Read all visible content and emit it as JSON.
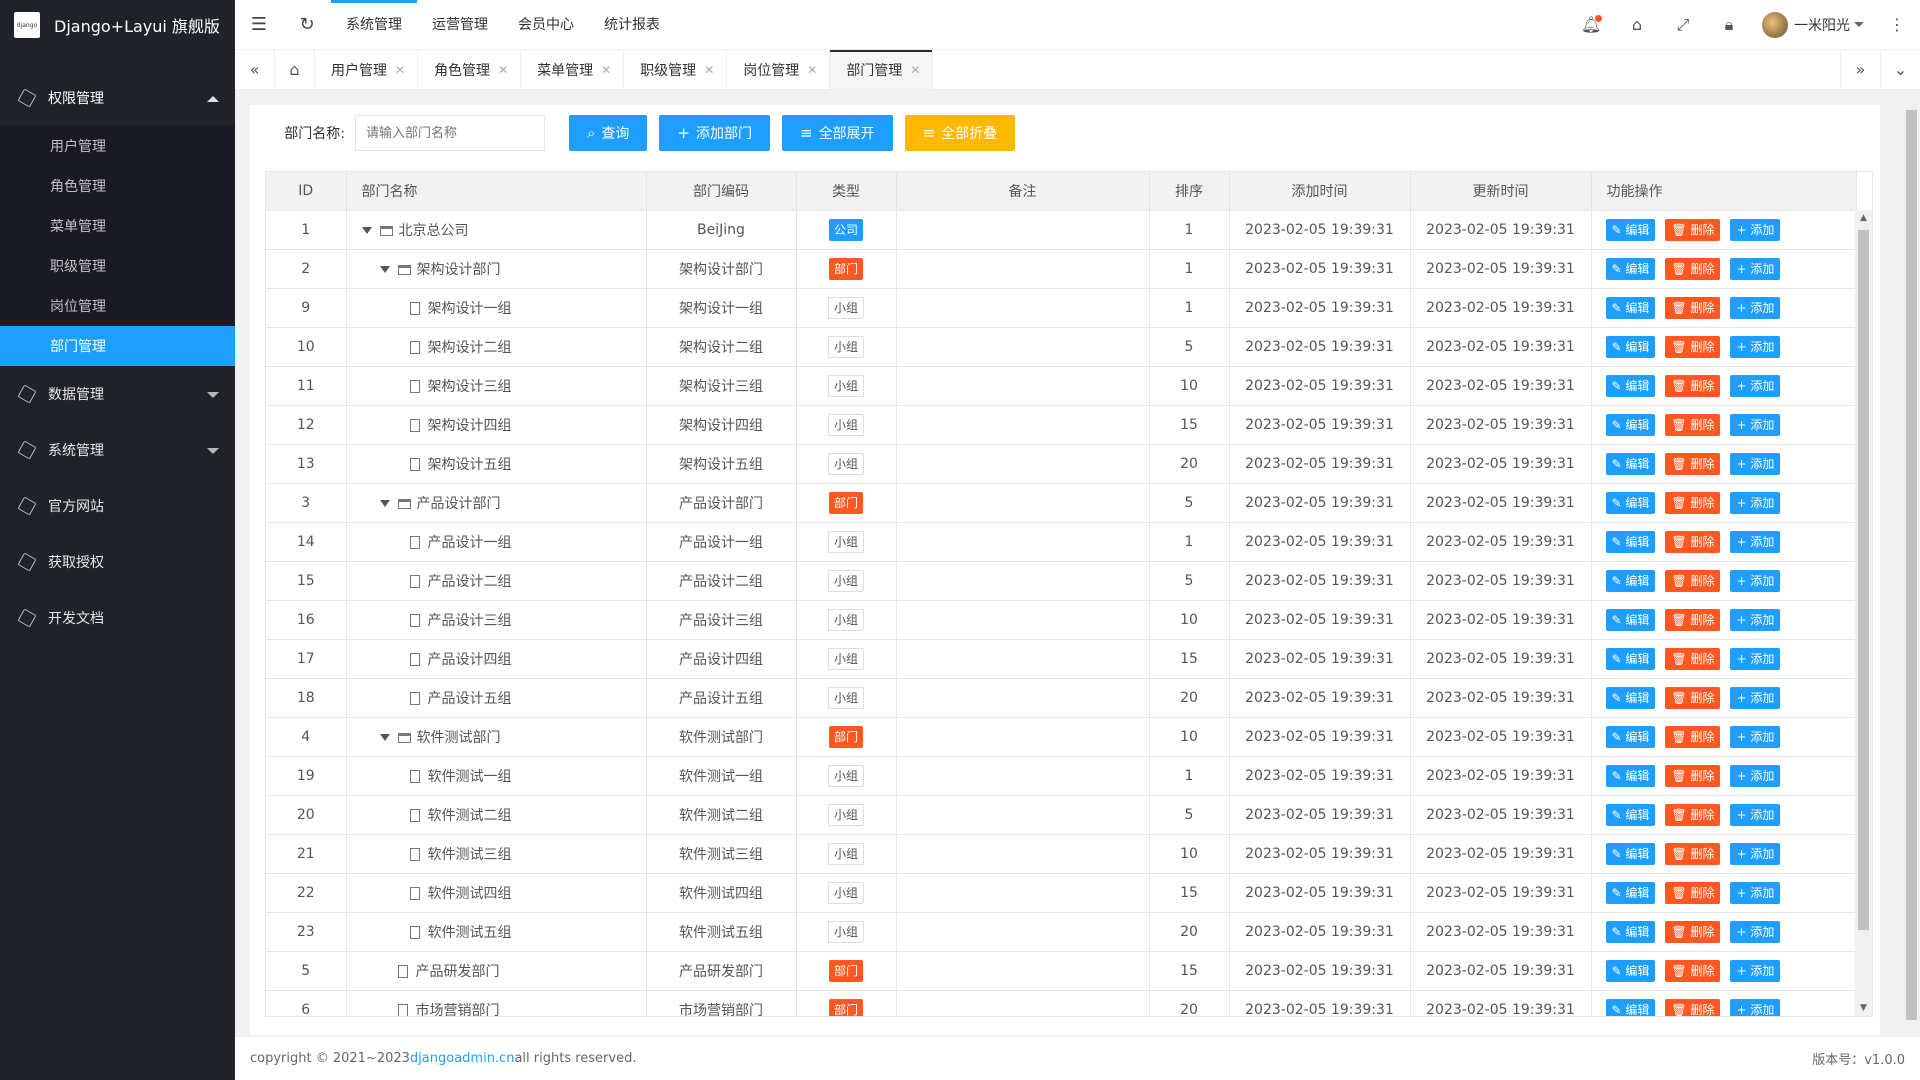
{
  "app": {
    "title": "Django+Layui 旗舰版",
    "logo_text": "django"
  },
  "sidebar": {
    "groups": [
      {
        "label": "权限管理",
        "expanded": true,
        "icon": "cube-icon",
        "items": [
          {
            "label": "用户管理",
            "active": false
          },
          {
            "label": "角色管理",
            "active": false
          },
          {
            "label": "菜单管理",
            "active": false
          },
          {
            "label": "职级管理",
            "active": false
          },
          {
            "label": "岗位管理",
            "active": false
          },
          {
            "label": "部门管理",
            "active": true
          }
        ]
      },
      {
        "label": "数据管理",
        "expanded": false,
        "has_children": true
      },
      {
        "label": "系统管理",
        "expanded": false,
        "has_children": true
      },
      {
        "label": "官方网站",
        "expanded": false,
        "has_children": false
      },
      {
        "label": "获取授权",
        "expanded": false,
        "has_children": false
      },
      {
        "label": "开发文档",
        "expanded": false,
        "has_children": false
      }
    ]
  },
  "header": {
    "menu": [
      "系统管理",
      "运营管理",
      "会员中心",
      "统计报表"
    ],
    "active_menu": 0,
    "user_name": "一米阳光"
  },
  "tabs": {
    "items": [
      "用户管理",
      "角色管理",
      "菜单管理",
      "职级管理",
      "岗位管理",
      "部门管理"
    ],
    "active": 5
  },
  "search": {
    "label": "部门名称:",
    "placeholder": "请输入部门名称",
    "buttons": {
      "query": "查询",
      "add": "添加部门",
      "expand": "全部展开",
      "collapse": "全部折叠"
    }
  },
  "table": {
    "columns": [
      "ID",
      "部门名称",
      "部门编码",
      "类型",
      "备注",
      "排序",
      "添加时间",
      "更新时间",
      "功能操作"
    ],
    "ops": {
      "edit": "编辑",
      "delete": "删除",
      "add": "添加"
    },
    "type_labels": {
      "company": "公司",
      "dept": "部门",
      "group": "小组"
    },
    "rows": [
      {
        "id": "1",
        "name": "北京总公司",
        "code": "BeiJing",
        "type": "company",
        "level": 0,
        "node": "folder",
        "sort": "1",
        "created": "2023-02-05 19:39:31",
        "updated": "2023-02-05 19:39:31"
      },
      {
        "id": "2",
        "name": "架构设计部门",
        "code": "架构设计部门",
        "type": "dept",
        "level": 1,
        "node": "folder",
        "sort": "1",
        "created": "2023-02-05 19:39:31",
        "updated": "2023-02-05 19:39:31"
      },
      {
        "id": "9",
        "name": "架构设计一组",
        "code": "架构设计一组",
        "type": "group",
        "level": 2,
        "node": "file",
        "sort": "1",
        "created": "2023-02-05 19:39:31",
        "updated": "2023-02-05 19:39:31"
      },
      {
        "id": "10",
        "name": "架构设计二组",
        "code": "架构设计二组",
        "type": "group",
        "level": 2,
        "node": "file",
        "sort": "5",
        "created": "2023-02-05 19:39:31",
        "updated": "2023-02-05 19:39:31"
      },
      {
        "id": "11",
        "name": "架构设计三组",
        "code": "架构设计三组",
        "type": "group",
        "level": 2,
        "node": "file",
        "sort": "10",
        "created": "2023-02-05 19:39:31",
        "updated": "2023-02-05 19:39:31"
      },
      {
        "id": "12",
        "name": "架构设计四组",
        "code": "架构设计四组",
        "type": "group",
        "level": 2,
        "node": "file",
        "sort": "15",
        "created": "2023-02-05 19:39:31",
        "updated": "2023-02-05 19:39:31"
      },
      {
        "id": "13",
        "name": "架构设计五组",
        "code": "架构设计五组",
        "type": "group",
        "level": 2,
        "node": "file",
        "sort": "20",
        "created": "2023-02-05 19:39:31",
        "updated": "2023-02-05 19:39:31"
      },
      {
        "id": "3",
        "name": "产品设计部门",
        "code": "产品设计部门",
        "type": "dept",
        "level": 1,
        "node": "folder",
        "sort": "5",
        "created": "2023-02-05 19:39:31",
        "updated": "2023-02-05 19:39:31"
      },
      {
        "id": "14",
        "name": "产品设计一组",
        "code": "产品设计一组",
        "type": "group",
        "level": 2,
        "node": "file",
        "sort": "1",
        "created": "2023-02-05 19:39:31",
        "updated": "2023-02-05 19:39:31"
      },
      {
        "id": "15",
        "name": "产品设计二组",
        "code": "产品设计二组",
        "type": "group",
        "level": 2,
        "node": "file",
        "sort": "5",
        "created": "2023-02-05 19:39:31",
        "updated": "2023-02-05 19:39:31"
      },
      {
        "id": "16",
        "name": "产品设计三组",
        "code": "产品设计三组",
        "type": "group",
        "level": 2,
        "node": "file",
        "sort": "10",
        "created": "2023-02-05 19:39:31",
        "updated": "2023-02-05 19:39:31"
      },
      {
        "id": "17",
        "name": "产品设计四组",
        "code": "产品设计四组",
        "type": "group",
        "level": 2,
        "node": "file",
        "sort": "15",
        "created": "2023-02-05 19:39:31",
        "updated": "2023-02-05 19:39:31"
      },
      {
        "id": "18",
        "name": "产品设计五组",
        "code": "产品设计五组",
        "type": "group",
        "level": 2,
        "node": "file",
        "sort": "20",
        "created": "2023-02-05 19:39:31",
        "updated": "2023-02-05 19:39:31"
      },
      {
        "id": "4",
        "name": "软件测试部门",
        "code": "软件测试部门",
        "type": "dept",
        "level": 1,
        "node": "folder",
        "sort": "10",
        "created": "2023-02-05 19:39:31",
        "updated": "2023-02-05 19:39:31"
      },
      {
        "id": "19",
        "name": "软件测试一组",
        "code": "软件测试一组",
        "type": "group",
        "level": 2,
        "node": "file",
        "sort": "1",
        "created": "2023-02-05 19:39:31",
        "updated": "2023-02-05 19:39:31"
      },
      {
        "id": "20",
        "name": "软件测试二组",
        "code": "软件测试二组",
        "type": "group",
        "level": 2,
        "node": "file",
        "sort": "5",
        "created": "2023-02-05 19:39:31",
        "updated": "2023-02-05 19:39:31"
      },
      {
        "id": "21",
        "name": "软件测试三组",
        "code": "软件测试三组",
        "type": "group",
        "level": 2,
        "node": "file",
        "sort": "10",
        "created": "2023-02-05 19:39:31",
        "updated": "2023-02-05 19:39:31"
      },
      {
        "id": "22",
        "name": "软件测试四组",
        "code": "软件测试四组",
        "type": "group",
        "level": 2,
        "node": "file",
        "sort": "15",
        "created": "2023-02-05 19:39:31",
        "updated": "2023-02-05 19:39:31"
      },
      {
        "id": "23",
        "name": "软件测试五组",
        "code": "软件测试五组",
        "type": "group",
        "level": 2,
        "node": "file",
        "sort": "20",
        "created": "2023-02-05 19:39:31",
        "updated": "2023-02-05 19:39:31"
      },
      {
        "id": "5",
        "name": "产品研发部门",
        "code": "产品研发部门",
        "type": "dept",
        "level": 1,
        "node": "leaf-folder",
        "sort": "15",
        "created": "2023-02-05 19:39:31",
        "updated": "2023-02-05 19:39:31"
      },
      {
        "id": "6",
        "name": "市场营销部门",
        "code": "市场营销部门",
        "type": "dept",
        "level": 1,
        "node": "leaf-folder",
        "sort": "20",
        "created": "2023-02-05 19:39:31",
        "updated": "2023-02-05 19:39:31"
      }
    ]
  },
  "footer": {
    "copyright_prefix": "copyright © 2021~2023 ",
    "link_text": "djangoadmin.cn",
    "copyright_suffix": " all rights reserved.",
    "version": "版本号：v1.0.0"
  },
  "colors": {
    "accent": "#1e9fff",
    "danger": "#ff5722",
    "warning": "#ffb800",
    "sidebar": "#20222a"
  }
}
